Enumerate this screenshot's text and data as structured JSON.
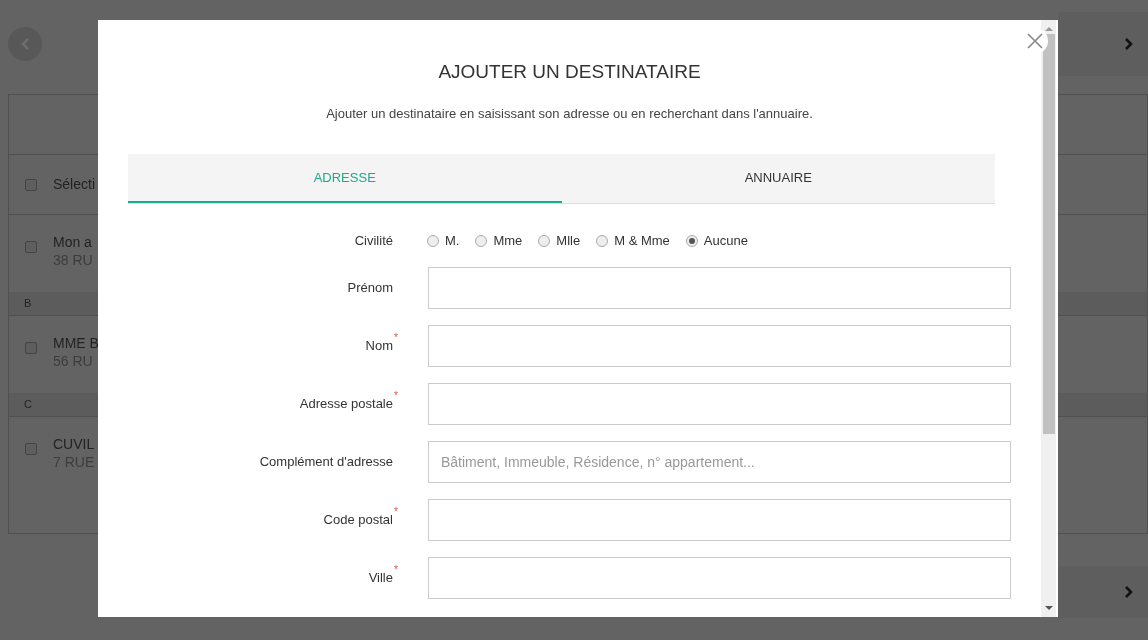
{
  "background": {
    "select_all": {
      "label": "Sélecti",
      "checked": false
    },
    "groups": [
      {
        "contacts": [
          {
            "name": "Mon a",
            "address": "38 RU",
            "checked": false
          }
        ]
      },
      {
        "letter": "B",
        "contacts": [
          {
            "name": "MME B",
            "address": "56 RU",
            "checked": false
          }
        ]
      },
      {
        "letter": "C",
        "contacts": [
          {
            "name": "CUVIL",
            "address": "7 RUE",
            "checked": false
          }
        ]
      }
    ]
  },
  "dialog": {
    "title": "AJOUTER UN DESTINATAIRE",
    "subtitle": "Ajouter un destinataire en saisissant son adresse ou en recherchant dans l'annuaire.",
    "tabs": [
      {
        "label": "ADRESSE",
        "selected": true
      },
      {
        "label": "ANNUAIRE",
        "selected": false
      }
    ],
    "civility": {
      "label": "Civilité",
      "options": [
        {
          "label": "M.",
          "selected": false
        },
        {
          "label": "Mme",
          "selected": false
        },
        {
          "label": "Mlle",
          "selected": false
        },
        {
          "label": "M & Mme",
          "selected": false
        },
        {
          "label": "Aucune",
          "selected": true
        }
      ]
    },
    "fields": [
      {
        "label": "Prénom"
      },
      {
        "label": "Nom",
        "required_mark": "*"
      },
      {
        "label": "Adresse postale",
        "required_mark": "*"
      },
      {
        "label": "Complément d'adresse",
        "placeholder": "Bâtiment, Immeuble, Résidence, n° appartement..."
      },
      {
        "label": "Code postal",
        "required_mark": "*"
      },
      {
        "label": "Ville",
        "required_mark": "*"
      }
    ]
  }
}
